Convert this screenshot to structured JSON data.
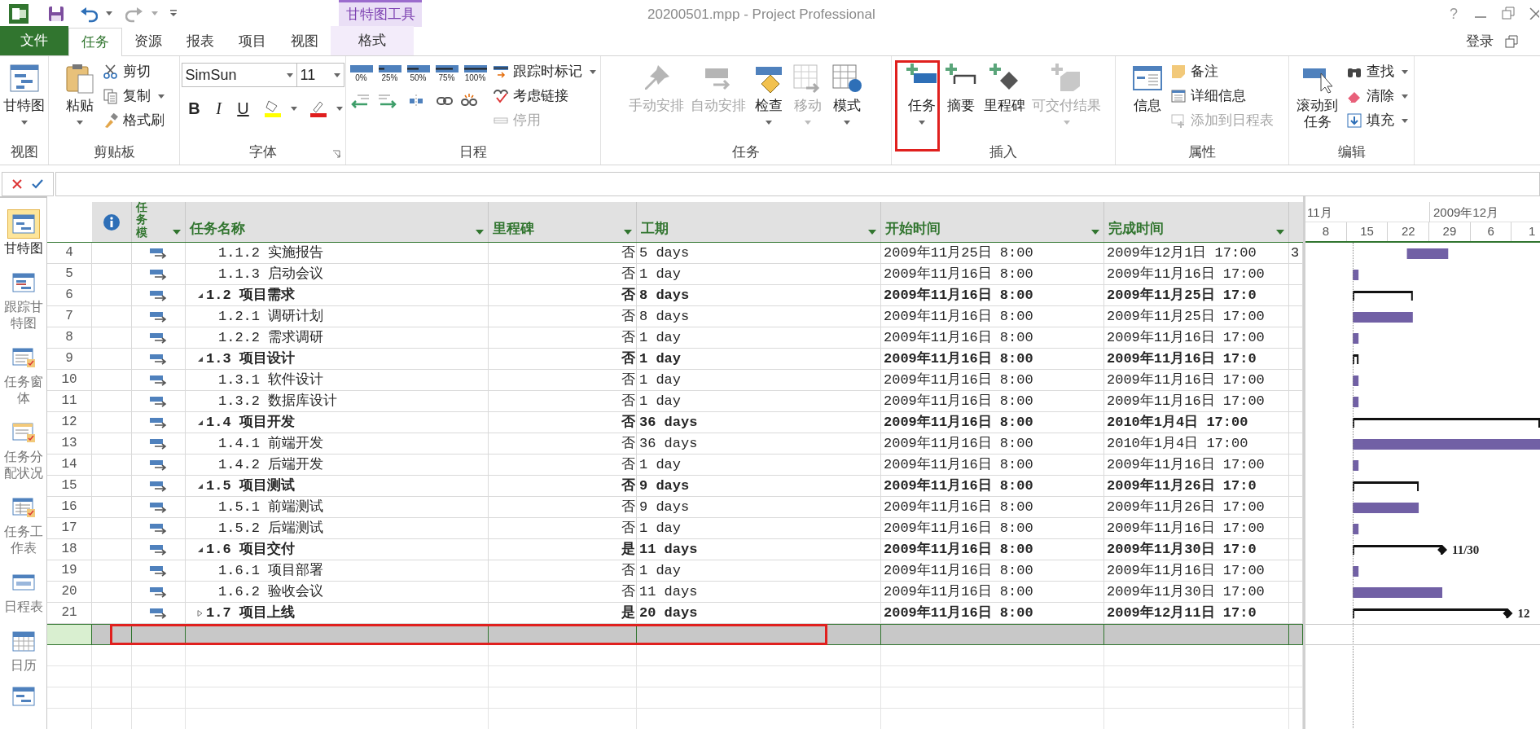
{
  "title_bar": {
    "context_tab": "甘特图工具",
    "title": "20200501.mpp - Project Professional",
    "help": "?"
  },
  "tabs": [
    {
      "label": "文件",
      "kind": "file",
      "selected": false
    },
    {
      "label": "任务",
      "kind": "normal",
      "selected": true
    },
    {
      "label": "资源",
      "kind": "normal",
      "selected": false
    },
    {
      "label": "报表",
      "kind": "normal",
      "selected": false
    },
    {
      "label": "项目",
      "kind": "normal",
      "selected": false
    },
    {
      "label": "视图",
      "kind": "normal",
      "selected": false
    },
    {
      "label": "格式",
      "kind": "context",
      "selected": false
    }
  ],
  "account": {
    "label": "登录"
  },
  "ribbon": [
    {
      "label": "视图",
      "items": [
        {
          "kind": "large",
          "label": "甘特图",
          "dropdown": true,
          "disabled": false
        }
      ]
    },
    {
      "label": "剪贴板",
      "items": [
        {
          "kind": "large",
          "label": "粘贴",
          "dropdown": true,
          "disabled": false
        },
        {
          "kind": "stack",
          "items": [
            {
              "label": "剪切",
              "dropdown": false,
              "disabled": false
            },
            {
              "label": "复制",
              "dropdown": true,
              "disabled": false
            },
            {
              "label": "格式刷",
              "dropdown": false,
              "disabled": false
            }
          ]
        }
      ]
    },
    {
      "label": "字体",
      "launcher": true,
      "items": [
        {
          "kind": "font",
          "font": "SimSun",
          "size": "11",
          "styles": [
            "B",
            "I",
            "U"
          ]
        }
      ]
    },
    {
      "label": "日程",
      "items": [
        {
          "kind": "schedule",
          "progress": [
            "0%",
            "25%",
            "50%",
            "75%",
            "100%"
          ]
        },
        {
          "kind": "stack",
          "items": [
            {
              "label": "跟踪时标记",
              "dropdown": true,
              "disabled": false
            },
            {
              "label": "考虑链接",
              "dropdown": false,
              "disabled": false
            },
            {
              "label": "停用",
              "dropdown": false,
              "disabled": true
            }
          ]
        }
      ]
    },
    {
      "label": "任务",
      "items": [
        {
          "kind": "large",
          "label": "手动安排",
          "dropdown": false,
          "disabled": true
        },
        {
          "kind": "large",
          "label": "自动安排",
          "dropdown": false,
          "disabled": true
        },
        {
          "kind": "large",
          "label": "检查",
          "dropdown": true,
          "disabled": false
        },
        {
          "kind": "large",
          "label": "移动",
          "dropdown": true,
          "disabled": true
        },
        {
          "kind": "large",
          "label": "模式",
          "dropdown": true,
          "disabled": false
        }
      ]
    },
    {
      "label": "插入",
      "items": [
        {
          "kind": "large",
          "label": "任务",
          "dropdown": true,
          "disabled": false
        },
        {
          "kind": "large",
          "label": "摘要",
          "dropdown": false,
          "disabled": false
        },
        {
          "kind": "large",
          "label": "里程碑",
          "dropdown": false,
          "disabled": false
        },
        {
          "kind": "large",
          "label": "可交付结果",
          "dropdown": true,
          "disabled": true
        }
      ]
    },
    {
      "label": "属性",
      "items": [
        {
          "kind": "large",
          "label": "信息",
          "dropdown": false,
          "disabled": false
        },
        {
          "kind": "stack",
          "items": [
            {
              "label": "备注",
              "dropdown": false,
              "disabled": false
            },
            {
              "label": "详细信息",
              "dropdown": false,
              "disabled": false
            },
            {
              "label": "添加到日程表",
              "dropdown": false,
              "disabled": true
            }
          ]
        }
      ]
    },
    {
      "label": "编辑",
      "items": [
        {
          "kind": "large_wrapped",
          "label": "滚动到任务",
          "dropdown": false,
          "disabled": false
        },
        {
          "kind": "stack",
          "items": [
            {
              "label": "查找",
              "dropdown": true,
              "disabled": false
            },
            {
              "label": "清除",
              "dropdown": true,
              "disabled": false
            },
            {
              "label": "填充",
              "dropdown": true,
              "disabled": false
            }
          ]
        }
      ]
    }
  ],
  "views": [
    {
      "label": "甘特图",
      "selected": true
    },
    {
      "label": "跟踪甘特图",
      "selected": false
    },
    {
      "label": "任务窗体",
      "selected": false
    },
    {
      "label": "任务分配状况",
      "selected": false
    },
    {
      "label": "任务工作表",
      "selected": false
    },
    {
      "label": "日程表",
      "selected": false
    },
    {
      "label": "日历",
      "selected": false
    }
  ],
  "table": {
    "columns": [
      {
        "label": "任务模"
      },
      {
        "label": "任务名称"
      },
      {
        "label": "里程碑"
      },
      {
        "label": "工期"
      },
      {
        "label": "开始时间"
      },
      {
        "label": "完成时间"
      }
    ],
    "rows": [
      {
        "id": "4",
        "name": "1.1.2 实施报告",
        "milestone": "否",
        "duration": "5 days",
        "start": "2009年11月25日 8:00",
        "finish": "2009年12月1日 17:00",
        "column_8": "3"
      },
      {
        "id": "5",
        "name": "1.1.3 启动会议",
        "milestone": "否",
        "duration": "1 day",
        "start": "2009年11月16日 8:00",
        "finish": "2009年11月16日 17:00"
      },
      {
        "id": "6",
        "name": "1.2 项目需求",
        "expanded": true,
        "milestone": "否",
        "duration": "8 days",
        "start": "2009年11月16日 8:00",
        "finish": "2009年11月25日 17:0",
        "children": [
          {
            "id": "7",
            "name": "1.2.1 调研计划",
            "milestone": "否",
            "duration": "8 days",
            "start": "2009年11月16日 8:00",
            "finish": "2009年11月25日 17:00"
          },
          {
            "id": "8",
            "name": "1.2.2 需求调研",
            "milestone": "否",
            "duration": "1 day",
            "start": "2009年11月16日 8:00",
            "finish": "2009年11月16日 17:00"
          }
        ]
      },
      {
        "id": "9",
        "name": "1.3 项目设计",
        "expanded": true,
        "milestone": "否",
        "duration": "1 day",
        "start": "2009年11月16日 8:00",
        "finish": "2009年11月16日 17:0",
        "children": [
          {
            "id": "10",
            "name": "1.3.1 软件设计",
            "milestone": "否",
            "duration": "1 day",
            "start": "2009年11月16日 8:00",
            "finish": "2009年11月16日 17:00"
          },
          {
            "id": "11",
            "name": "1.3.2 数据库设计",
            "milestone": "否",
            "duration": "1 day",
            "start": "2009年11月16日 8:00",
            "finish": "2009年11月16日 17:00"
          }
        ]
      },
      {
        "id": "12",
        "name": "1.4 项目开发",
        "expanded": true,
        "milestone": "否",
        "duration": "36 days",
        "start": "2009年11月16日 8:00",
        "finish": "2010年1月4日 17:00",
        "children": [
          {
            "id": "13",
            "name": "1.4.1 前端开发",
            "milestone": "否",
            "duration": "36 days",
            "start": "2009年11月16日 8:00",
            "finish": "2010年1月4日 17:00"
          },
          {
            "id": "14",
            "name": "1.4.2 后端开发",
            "milestone": "否",
            "duration": "1 day",
            "start": "2009年11月16日 8:00",
            "finish": "2009年11月16日 17:00"
          }
        ]
      },
      {
        "id": "15",
        "name": "1.5 项目测试",
        "expanded": true,
        "milestone": "否",
        "duration": "9 days",
        "start": "2009年11月16日 8:00",
        "finish": "2009年11月26日 17:0",
        "children": [
          {
            "id": "16",
            "name": "1.5.1 前端测试",
            "milestone": "否",
            "duration": "9 days",
            "start": "2009年11月16日 8:00",
            "finish": "2009年11月26日 17:00"
          },
          {
            "id": "17",
            "name": "1.5.2 后端测试",
            "milestone": "否",
            "duration": "1 day",
            "start": "2009年11月16日 8:00",
            "finish": "2009年11月16日 17:00"
          }
        ]
      },
      {
        "id": "18",
        "name": "1.6 项目交付",
        "expanded": true,
        "milestone": "是",
        "duration": "11 days",
        "start": "2009年11月16日 8:00",
        "finish": "2009年11月30日 17:0",
        "gantt_label": "11/30",
        "children": [
          {
            "id": "19",
            "name": "1.6.1 项目部署",
            "milestone": "否",
            "duration": "1 day",
            "start": "2009年11月16日 8:00",
            "finish": "2009年11月16日 17:00"
          },
          {
            "id": "20",
            "name": "1.6.2 验收会议",
            "milestone": "否",
            "duration": "11 days",
            "start": "2009年11月16日 8:00",
            "finish": "2009年11月30日 17:00"
          }
        ]
      },
      {
        "id": "21",
        "name": "1.7 项目上线",
        "expanded": false,
        "milestone": "是",
        "duration": "20 days",
        "start": "2009年11月16日 8:00",
        "finish": "2009年12月11日 17:0",
        "gantt_label": "12"
      }
    ],
    "new_row": {
      "selected": true
    }
  },
  "gantt": {
    "months": [
      "11月",
      "2009年12月"
    ],
    "days": [
      "8",
      "15",
      "22",
      "29",
      "6",
      "1"
    ]
  }
}
